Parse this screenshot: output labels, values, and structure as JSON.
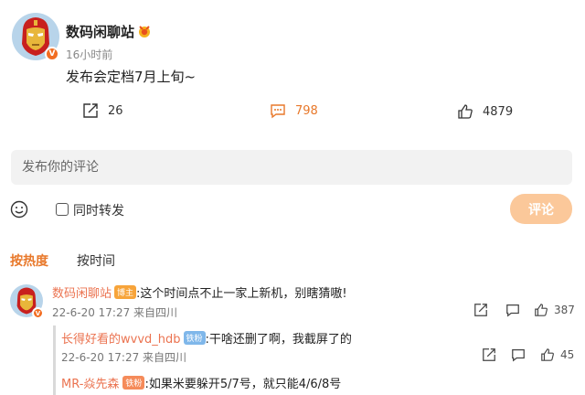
{
  "post": {
    "author": "数码闲聊站",
    "time": "16小时前",
    "text": "发布会定档7月上旬~",
    "verified_icon": "v-badge-icon",
    "actions": {
      "forward_count": "26",
      "comment_count": "798",
      "like_count": "4879"
    }
  },
  "composer": {
    "placeholder": "发布你的评论",
    "forward_label": "同时转发",
    "submit_label": "评论"
  },
  "sort": {
    "hot": "按热度",
    "time": "按时间"
  },
  "comments": [
    {
      "author": "数码闲聊站",
      "badge": "博主",
      "text": ":这个时间点不止一家上新机，别瞎猜嗷!",
      "meta": "22-6-20 17:27 来自四川",
      "like_count": "387"
    }
  ],
  "replies": [
    {
      "author": "长得好看的wvvd_hdb",
      "badge": "铁粉",
      "text": ":干啥还删了啊，我截屏了的",
      "meta": "22-6-20 17:27 来自四川",
      "like_count": "45"
    },
    {
      "author": "MR-焱先森",
      "badge": "铁粉",
      "text": ":如果米要躲开5/7号，就只能4/6/8号"
    }
  ],
  "colors": {
    "accent": "#e8782a",
    "name": "#eb7350",
    "submit_disabled": "#fbc89a",
    "input_bg": "#f2f2f2"
  }
}
